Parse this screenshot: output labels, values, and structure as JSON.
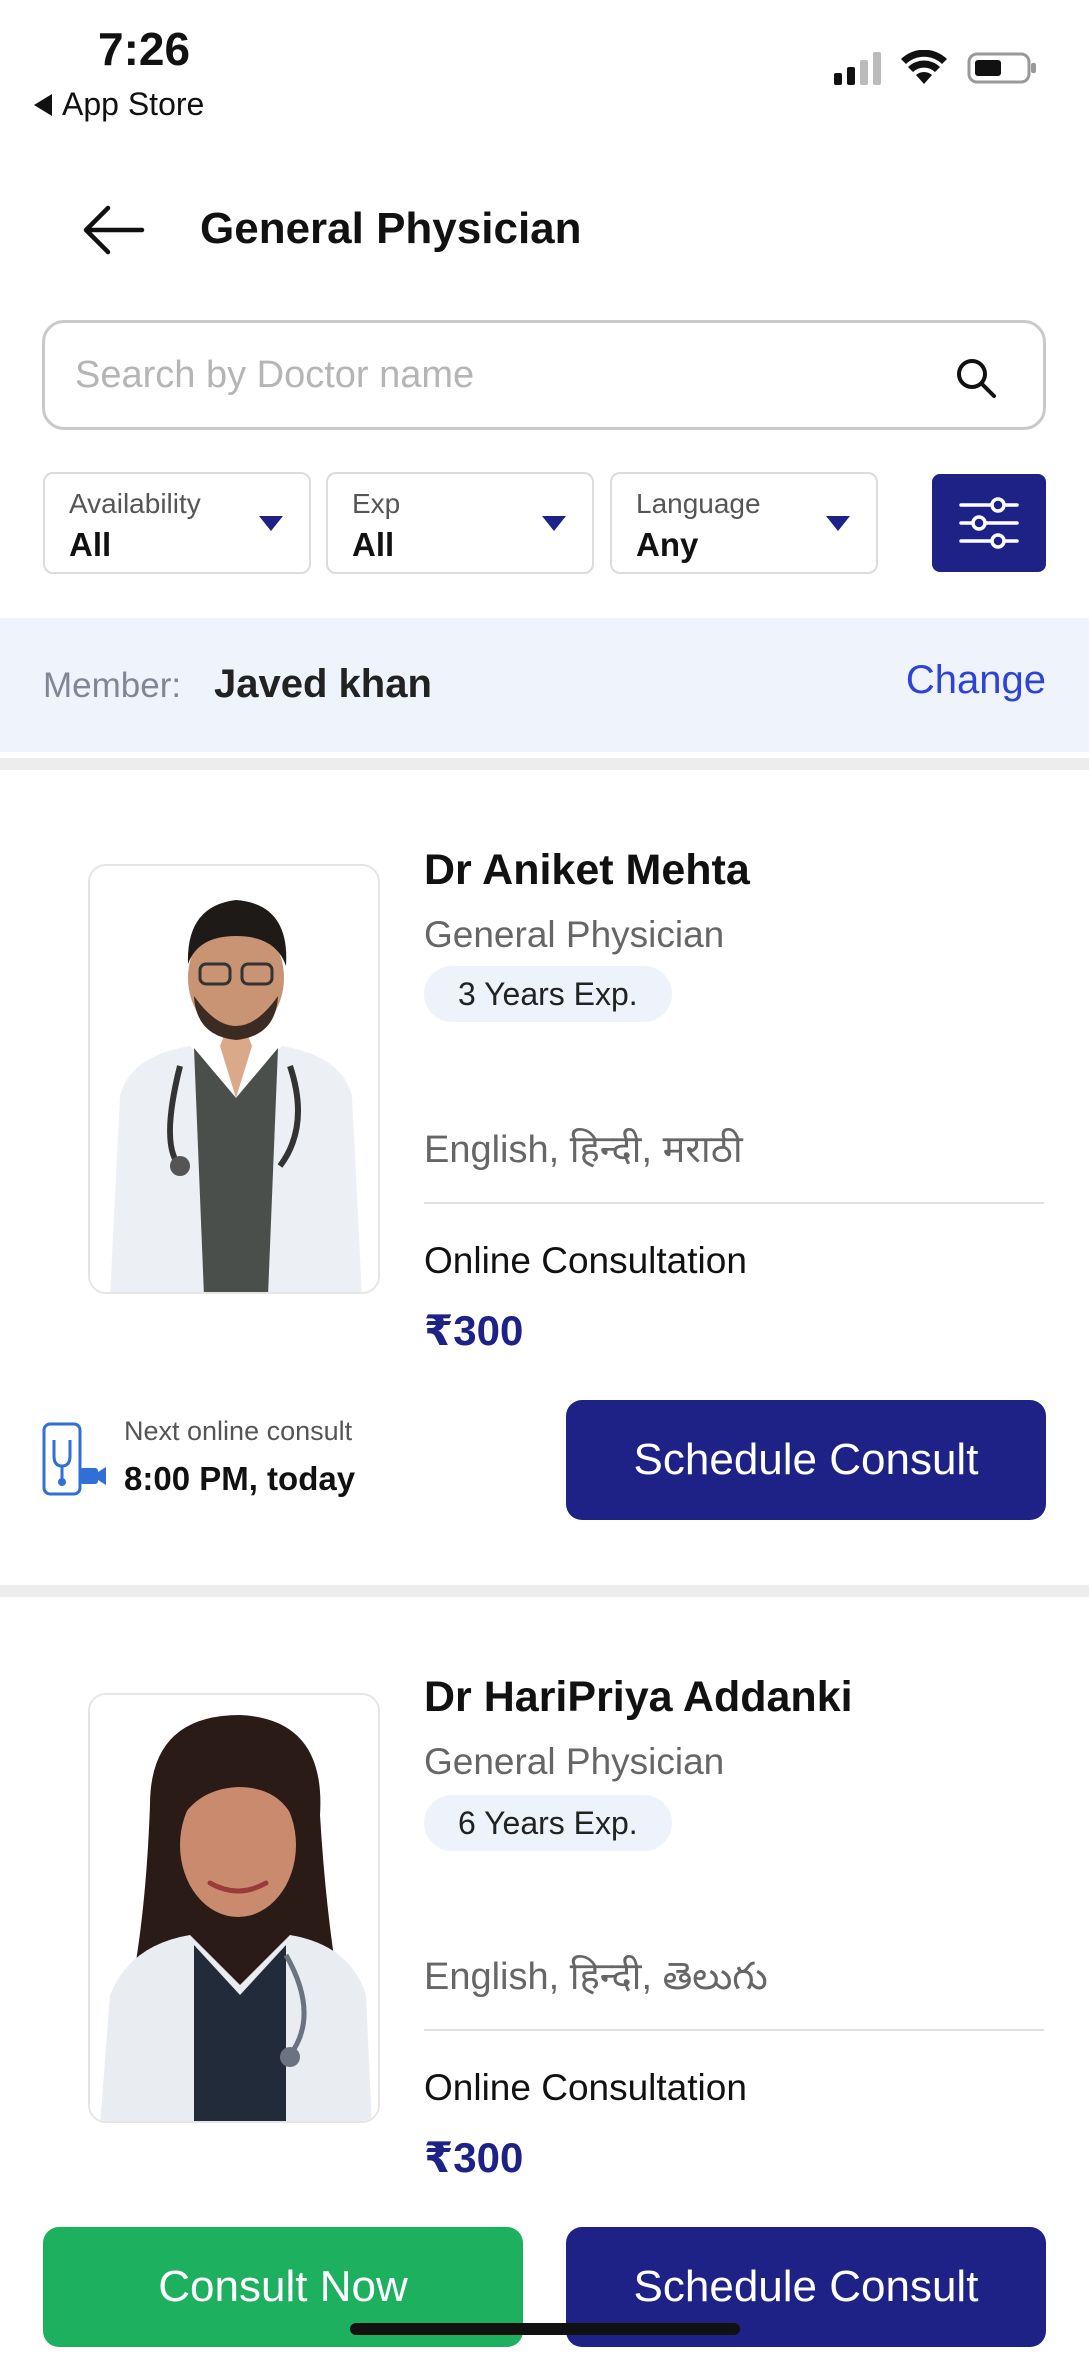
{
  "status_bar": {
    "time": "7:26",
    "back_app": "App Store"
  },
  "header": {
    "title": "General Physician"
  },
  "search": {
    "placeholder": "Search by Doctor name"
  },
  "filters": [
    {
      "label": "Availability",
      "value": "All"
    },
    {
      "label": "Exp",
      "value": "All"
    },
    {
      "label": "Language",
      "value": "Any"
    }
  ],
  "member": {
    "label": "Member:",
    "name": "Javed khan",
    "change": "Change"
  },
  "doctors": [
    {
      "name": "Dr Aniket Mehta",
      "specialty": "General Physician",
      "experience": "3 Years Exp.",
      "languages": "English, हिन्दी, मराठी",
      "consult_type": "Online Consultation",
      "price": "₹300",
      "next_label": "Next online consult",
      "next_time": "8:00 PM, today",
      "schedule_label": "Schedule Consult"
    },
    {
      "name": "Dr HariPriya Addanki",
      "specialty": "General Physician",
      "experience": "6 Years Exp.",
      "languages": "English, हिन्दी, తెలుగు",
      "consult_type": "Online Consultation",
      "price": "₹300",
      "consult_now_label": "Consult Now",
      "schedule_label": "Schedule Consult"
    }
  ],
  "colors": {
    "primary": "#1e2287",
    "success": "#1db15f",
    "link": "#2f43d6",
    "member_bg": "#eef3fc"
  }
}
